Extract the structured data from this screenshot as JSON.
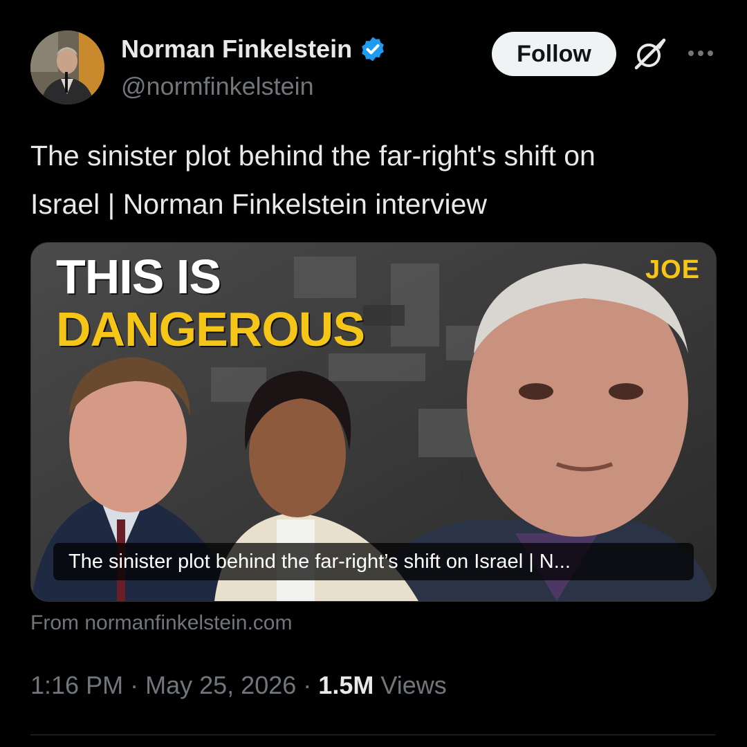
{
  "author": {
    "display_name": "Norman Finkelstein",
    "handle": "@normfinkelstein",
    "verified": true,
    "verified_color": "#1d9bf0"
  },
  "actions": {
    "follow_label": "Follow",
    "grok_icon": "grok-icon",
    "more_icon": "more-icon"
  },
  "tweet": {
    "text_line1": "The sinister plot behind the far-right's shift on",
    "text_line2": "Israel | Norman Finkelstein interview"
  },
  "card": {
    "thumbnail_headline_line1": "THIS IS",
    "thumbnail_headline_line2": "DANGEROUS",
    "thumbnail_logo": "JOE",
    "caption": "The sinister plot behind the far-right’s shift on Israel | N...",
    "source": "From normanfinkelstein.com",
    "accent_color": "#f5c518"
  },
  "meta": {
    "time": "1:16 PM",
    "separator": "·",
    "date": "May 25, 2026",
    "views_count": "1.5M",
    "views_label": "Views"
  }
}
